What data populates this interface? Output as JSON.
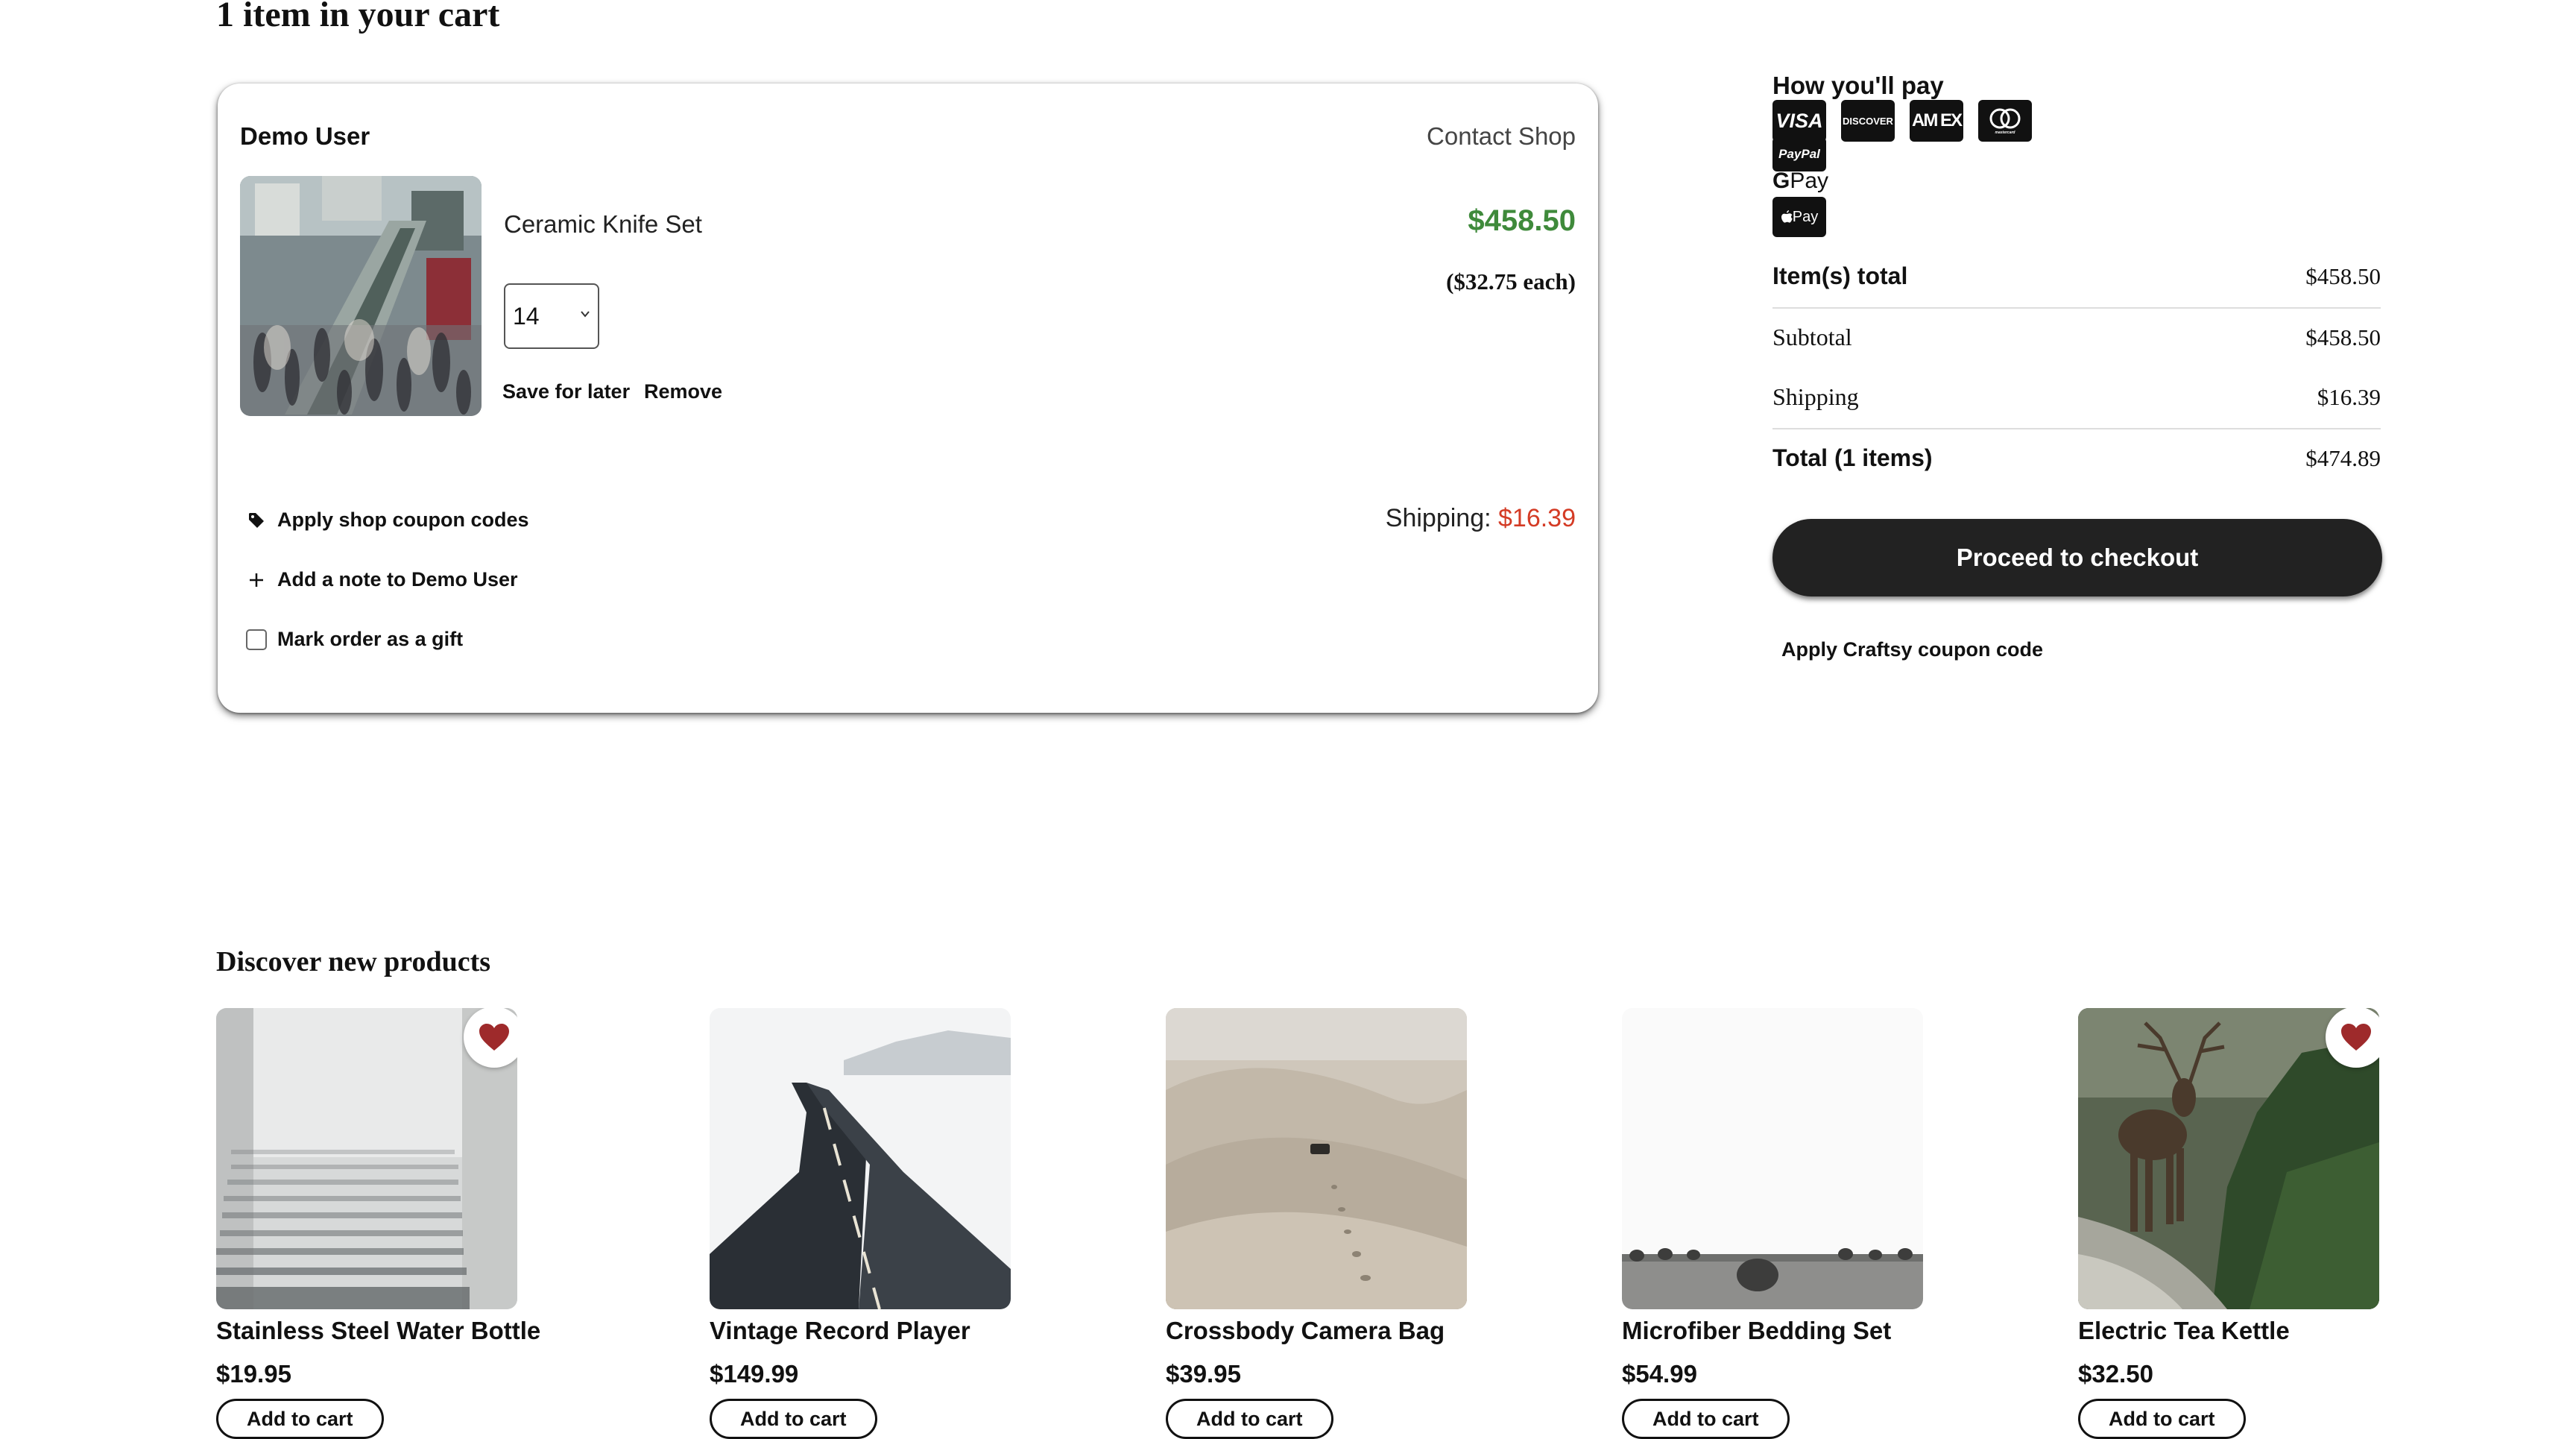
{
  "page": {
    "title": "1 item in your cart"
  },
  "shop": {
    "owner": "Demo User",
    "contact_label": "Contact Shop",
    "item": {
      "title": "Ceramic Knife Set",
      "price": "$458.50",
      "each": "($32.75 each)",
      "quantity": "14",
      "save_label": "Save for later",
      "remove_label": "Remove",
      "photo_icon": "crowded-escalator-photo"
    },
    "coupon_label": "Apply shop coupon codes",
    "note_label": "Add a note to Demo User",
    "gift_label": "Mark order as a gift",
    "gift_checked": false,
    "shipping_label": "Shipping:",
    "shipping_amount": "$16.39",
    "colors": {
      "price": "#3f8a3b",
      "shipping": "#d43b25"
    }
  },
  "summary": {
    "pay_heading": "How you'll pay",
    "payment_methods": {
      "visa": "VISA",
      "discover": "DISCOVER",
      "amex": "AM EX",
      "mastercard": "mastercard",
      "paypal": "PayPal",
      "gpay": "G Pay",
      "applepay": "Pay"
    },
    "items_total_label": "Item(s) total",
    "items_total_value": "$458.50",
    "subtotal_label": "Subtotal",
    "subtotal_value": "$458.50",
    "shipping_label": "Shipping",
    "shipping_value": "$16.39",
    "total_label": "Total (1 items)",
    "total_value": "$474.89",
    "checkout_label": "Proceed to checkout",
    "craftsy_coupon_label": "Apply Craftsy coupon code"
  },
  "discover": {
    "heading": "Discover new products",
    "add_label": "Add to cart",
    "products": [
      {
        "name": "Stainless Steel Water Bottle",
        "price": "$19.95",
        "favorited": true,
        "image": "foggy-stairs-photo"
      },
      {
        "name": "Vintage Record Player",
        "price": "$149.99",
        "favorited": false,
        "image": "snowy-road-photo"
      },
      {
        "name": "Crossbody Camera Bag",
        "price": "$39.95",
        "favorited": false,
        "image": "desert-dunes-photo"
      },
      {
        "name": "Microfiber Bedding Set",
        "price": "$54.99",
        "favorited": false,
        "image": "hay-bales-field-photo"
      },
      {
        "name": "Electric Tea Kettle",
        "price": "$32.50",
        "favorited": true,
        "image": "reindeer-stream-photo"
      }
    ]
  }
}
